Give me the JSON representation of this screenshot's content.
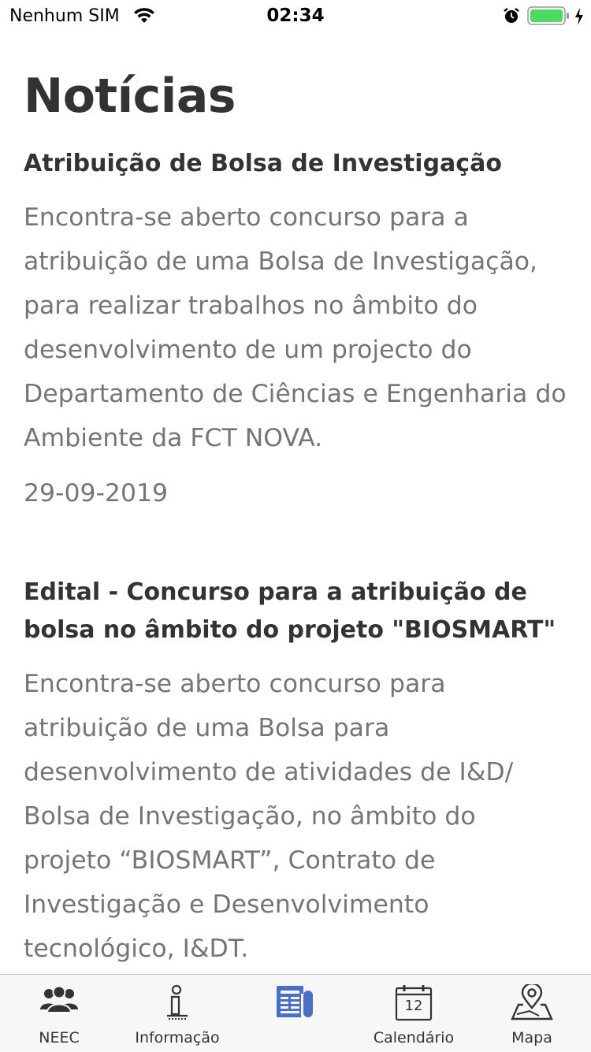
{
  "status_bar": {
    "carrier": "Nenhum SIM",
    "time": "02:34",
    "icons": [
      "wifi-icon",
      "alarm-icon",
      "battery-icon",
      "charging-icon"
    ]
  },
  "page": {
    "title": "Notícias"
  },
  "news": [
    {
      "title": "Atribuição de Bolsa de Investigação",
      "body": "Encontra-se aberto concurso para a atribuição de uma Bolsa de Investigação, para realizar trabalhos no âmbito do desenvolvimento de um projecto do Departamento de Ciências e Engenharia do Ambiente da FCT NOVA.",
      "date": "29-09-2019"
    },
    {
      "title": "Edital - Concurso para a atribuição de bolsa no âmbito do projeto \"BIOSMART\"",
      "body": "Encontra-se aberto concurso para atribuição de uma Bolsa para desenvolvimento de atividades de I&D/ Bolsa de Investigação, no âmbito do projeto “BIOSMART”, Contrato de Investigação e Desenvolvimento tecnológico, I&DT."
    }
  ],
  "tab_bar": {
    "tabs": [
      {
        "label": "NEEC",
        "icon": "group-icon"
      },
      {
        "label": "Informação",
        "icon": "info-icon"
      },
      {
        "label": "",
        "icon": "newspaper-icon",
        "selected": true
      },
      {
        "label": "Calendário",
        "icon": "calendar-icon",
        "day": "12"
      },
      {
        "label": "Mapa",
        "icon": "map-pin-icon"
      }
    ],
    "accent_color": "#4a6fc7"
  }
}
